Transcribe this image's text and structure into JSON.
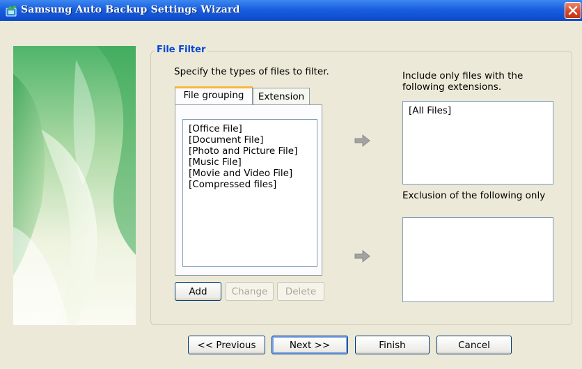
{
  "window": {
    "title": "Samsung Auto Backup Settings Wizard"
  },
  "group": {
    "title": "File Filter",
    "instruction": "Specify the types of files to filter."
  },
  "tabs": [
    {
      "label": "File grouping",
      "active": true
    },
    {
      "label": "Extension",
      "active": false
    }
  ],
  "file_groups": [
    "[Office File]",
    "[Document File]",
    "[Photo and Picture File]",
    "[Music File]",
    "[Movie and Video File]",
    "[Compressed files]"
  ],
  "list_buttons": {
    "add": "Add",
    "change": "Change",
    "delete": "Delete"
  },
  "include": {
    "label": "Include only files with the following extensions.",
    "items": [
      "[All Files]"
    ]
  },
  "exclude": {
    "label": "Exclusion of the following only",
    "items": []
  },
  "nav": {
    "previous": "<< Previous",
    "next": "Next >>",
    "finish": "Finish",
    "cancel": "Cancel"
  },
  "colors": {
    "titlebar": "#0b49c9",
    "group_title": "#0046d5",
    "tab_highlight": "#f7b73a",
    "window_bg": "#ece9d8"
  }
}
